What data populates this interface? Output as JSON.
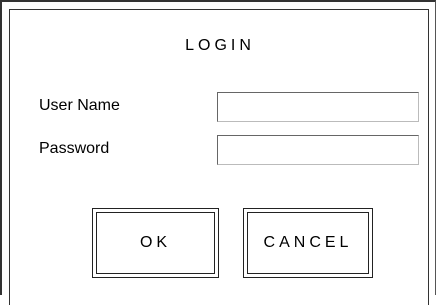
{
  "dialog": {
    "title": "LOGIN",
    "fields": {
      "username": {
        "label": "User Name",
        "value": "",
        "placeholder": ""
      },
      "password": {
        "label": "Password",
        "value": "",
        "placeholder": ""
      }
    },
    "buttons": {
      "ok": "OK",
      "cancel": "CANCEL"
    }
  }
}
